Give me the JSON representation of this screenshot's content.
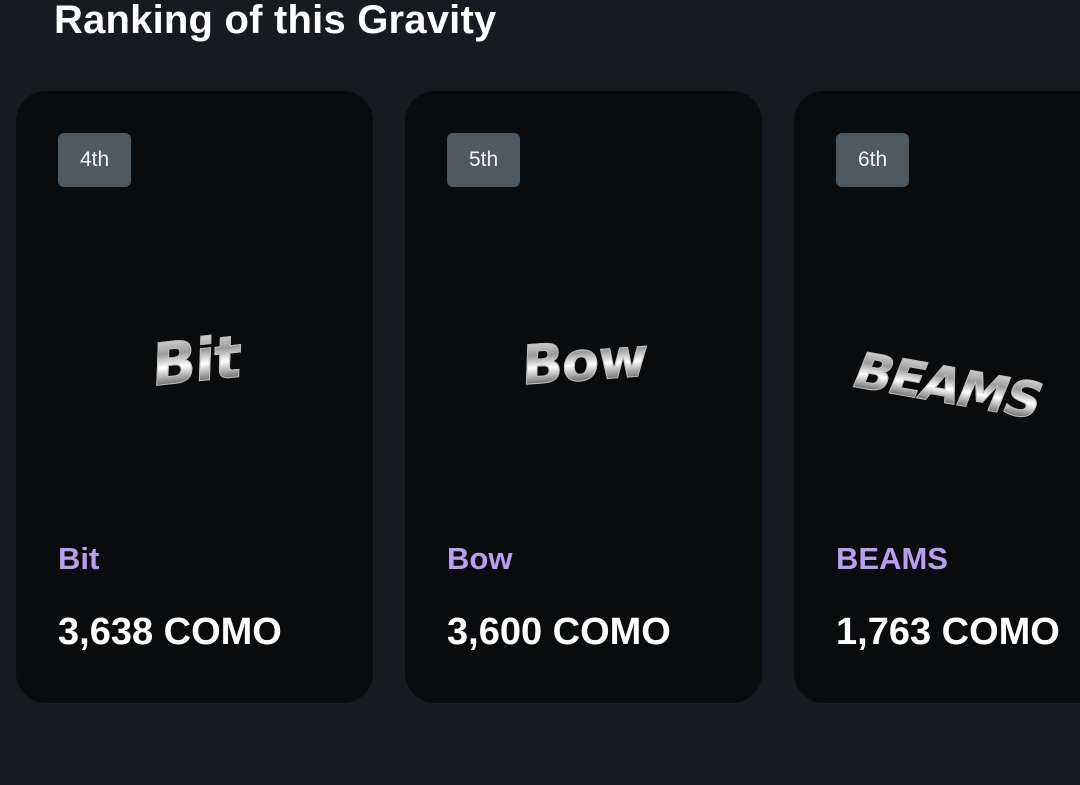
{
  "section": {
    "title": "Ranking of this Gravity"
  },
  "ranking": [
    {
      "rank": "4th",
      "art_text": "Bit",
      "name": "Bit",
      "como": "3,638 COMO"
    },
    {
      "rank": "5th",
      "art_text": "Bow",
      "name": "Bow",
      "como": "3,600 COMO"
    },
    {
      "rank": "6th",
      "art_text": "BEAMS",
      "name": "BEAMS",
      "como": "1,763 COMO"
    }
  ],
  "colors": {
    "background": "#171b1f",
    "card": "#0a0b0d",
    "badge": "#4e5961",
    "name_accent": "#b6a0ef",
    "text": "#ffffff"
  }
}
